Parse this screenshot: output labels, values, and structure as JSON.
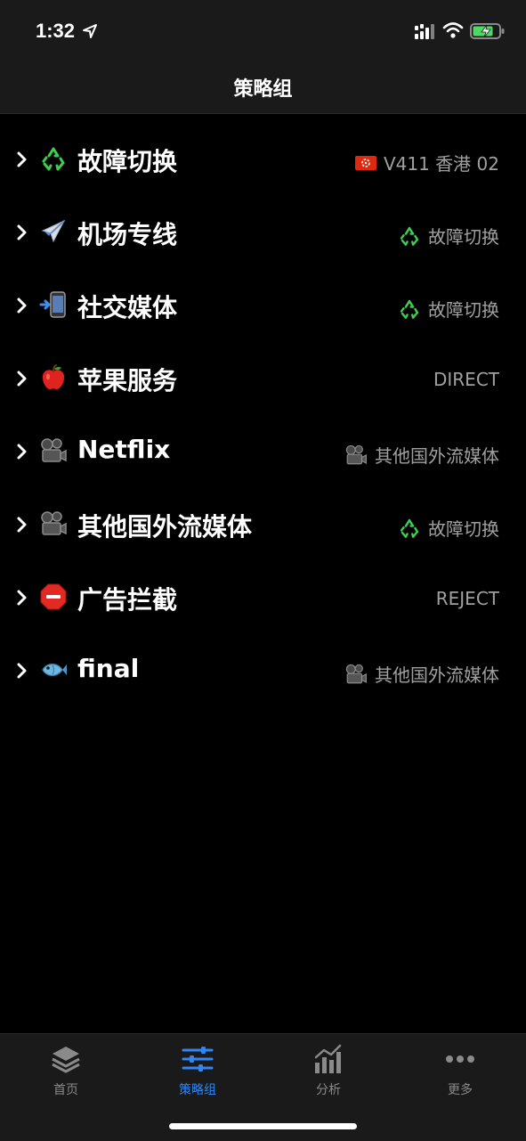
{
  "status_bar": {
    "time": "1:32"
  },
  "nav": {
    "title": "策略组"
  },
  "groups": [
    {
      "icon": "recycle-icon",
      "title": "故障切换",
      "value_icon": "hk-flag-icon",
      "value": "V411 香港 02"
    },
    {
      "icon": "airplane-icon",
      "title": "机场专线",
      "value_icon": "recycle-icon",
      "value": "故障切换"
    },
    {
      "icon": "phone-arrow-icon",
      "title": "社交媒体",
      "value_icon": "recycle-icon",
      "value": "故障切换"
    },
    {
      "icon": "apple-icon",
      "title": "苹果服务",
      "value_icon": "",
      "value": "DIRECT"
    },
    {
      "icon": "movie-camera-icon",
      "title": "Netflix",
      "value_icon": "movie-camera-icon",
      "value": "其他国外流媒体"
    },
    {
      "icon": "movie-camera-icon",
      "title": "其他国外流媒体",
      "value_icon": "recycle-icon",
      "value": "故障切换"
    },
    {
      "icon": "stop-sign-icon",
      "title": "广告拦截",
      "value_icon": "",
      "value": "REJECT"
    },
    {
      "icon": "fish-icon",
      "title": "final",
      "value_icon": "movie-camera-icon",
      "value": "其他国外流媒体"
    }
  ],
  "tabs": [
    {
      "icon": "layers-icon",
      "label": "首页",
      "active": false
    },
    {
      "icon": "sliders-icon",
      "label": "策略组",
      "active": true
    },
    {
      "icon": "bar-chart-icon",
      "label": "分析",
      "active": false
    },
    {
      "icon": "more-dots-icon",
      "label": "更多",
      "active": false
    }
  ],
  "colors": {
    "background": "#000000",
    "bar_background": "#1a1a1a",
    "accent_blue": "#2f86f6",
    "secondary_text": "#a0a0a0",
    "tab_inactive": "#8a8a8a",
    "battery_green": "#4cd964"
  }
}
